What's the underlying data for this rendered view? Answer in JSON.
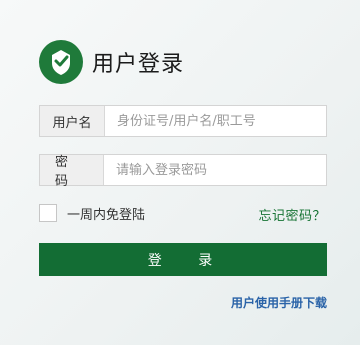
{
  "header": {
    "title": "用户登录",
    "logo_icon": "shield-check-logo",
    "logo_color": "#1f7a3a"
  },
  "username": {
    "label": "用户名",
    "placeholder": "身份证号/用户名/职工号",
    "value": ""
  },
  "password": {
    "label": "密码",
    "placeholder": "请输入登录密码",
    "value": ""
  },
  "remember": {
    "label": "一周内免登陆",
    "checked": false
  },
  "forgot_password": "忘记密码？",
  "login_button": "登 录",
  "manual_link": "用户使用手册下载",
  "colors": {
    "accent": "#136d34",
    "link_green": "#167333",
    "link_blue": "#2a63a8"
  }
}
